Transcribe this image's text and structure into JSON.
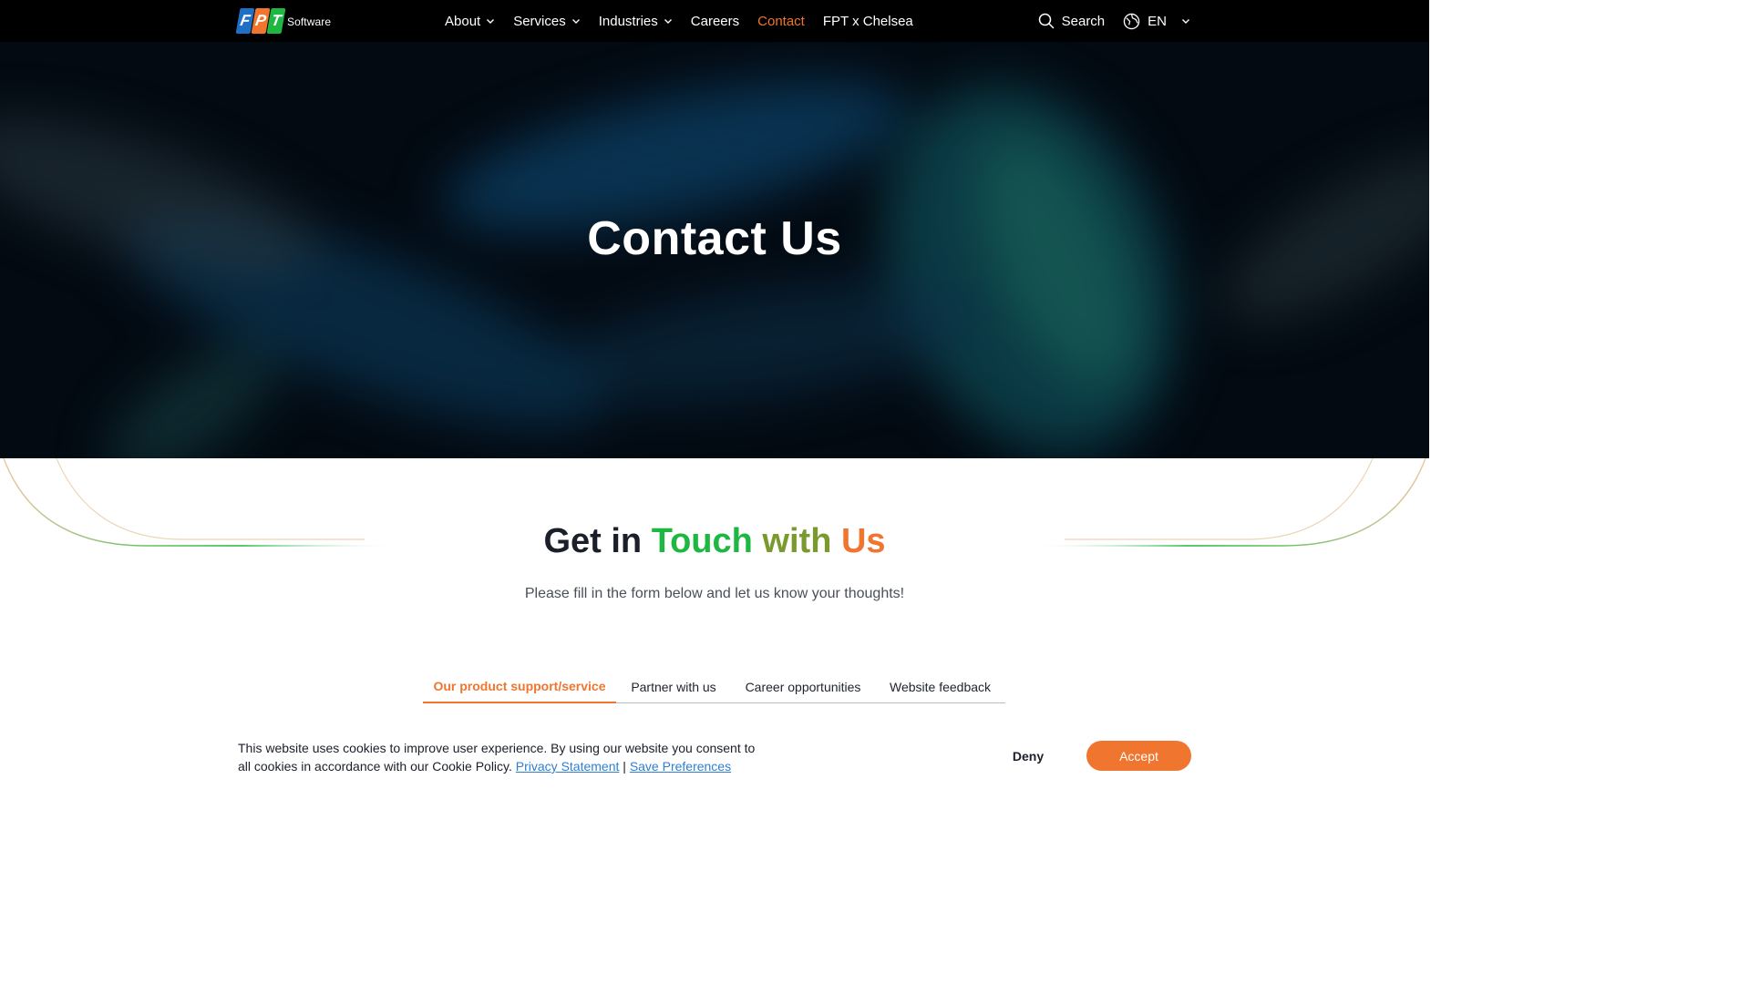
{
  "brand": {
    "logo_letters": [
      "F",
      "P",
      "T"
    ],
    "logo_word": "Software",
    "logo_colors": [
      "#1f6fc4",
      "#f0752e",
      "#1db742"
    ]
  },
  "nav": {
    "items": [
      {
        "label": "About",
        "has_dropdown": true
      },
      {
        "label": "Services",
        "has_dropdown": true
      },
      {
        "label": "Industries",
        "has_dropdown": true
      },
      {
        "label": "Careers",
        "has_dropdown": false
      },
      {
        "label": "Contact",
        "has_dropdown": false,
        "active": true
      },
      {
        "label": "FPT x Chelsea",
        "has_dropdown": false
      }
    ],
    "search_label": "Search",
    "search_icon": "search-icon",
    "language": "EN",
    "language_icon": "globe-icon"
  },
  "hero": {
    "title": "Contact Us"
  },
  "section": {
    "title_parts": [
      "Get in",
      "Touch",
      "with",
      "Us"
    ],
    "subtitle": "Please fill in the form below and let us know your thoughts!",
    "tabs": [
      "Our product support/service",
      "Partner with us",
      "Career opportunities",
      "Website feedback"
    ],
    "active_tab": 0
  },
  "cookie": {
    "text": "This website uses cookies to improve user experience. By using our website you consent to all cookies in accordance with our Cookie Policy.",
    "privacy_link": "Privacy Statement",
    "separator": "|",
    "preferences_link": "Save Preferences",
    "deny_label": "Deny",
    "accept_label": "Accept"
  },
  "colors": {
    "accent": "#f0752e",
    "green": "#1db742",
    "link": "#2f7fd1",
    "header_bg": "#000000"
  }
}
